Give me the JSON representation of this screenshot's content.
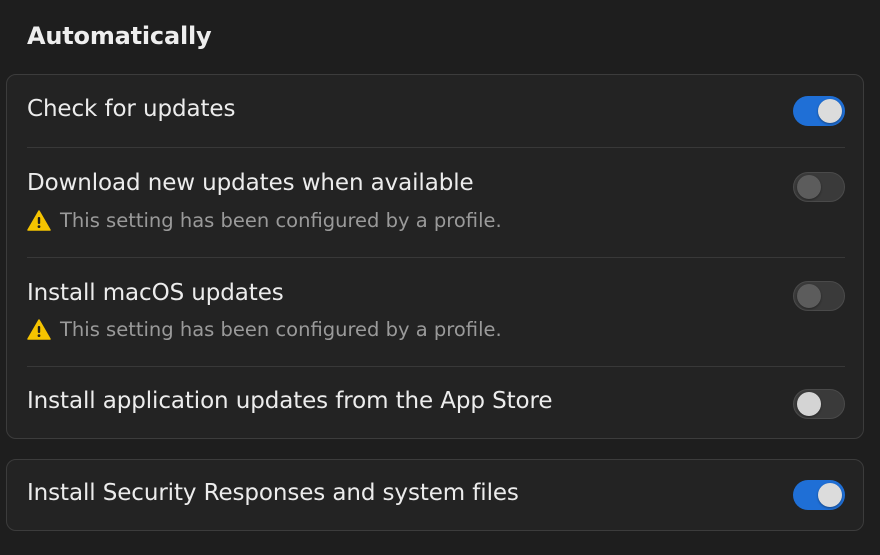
{
  "section": {
    "title": "Automatically"
  },
  "settings": [
    {
      "label": "Check for updates",
      "enabled": true,
      "note": ""
    },
    {
      "label": "Download new updates when available",
      "enabled": false,
      "note": "This setting has been configured by a profile."
    },
    {
      "label": "Install macOS updates",
      "enabled": false,
      "note": "This setting has been configured by a profile."
    },
    {
      "label": "Install application updates from the App Store",
      "enabled": false,
      "note": ""
    }
  ],
  "security": {
    "label": "Install Security Responses and system files",
    "enabled": true
  },
  "icons": {
    "warning": "warning-triangle-icon"
  },
  "colors": {
    "toggle_on": "#1f6fd6",
    "warning": "#f5c400"
  }
}
